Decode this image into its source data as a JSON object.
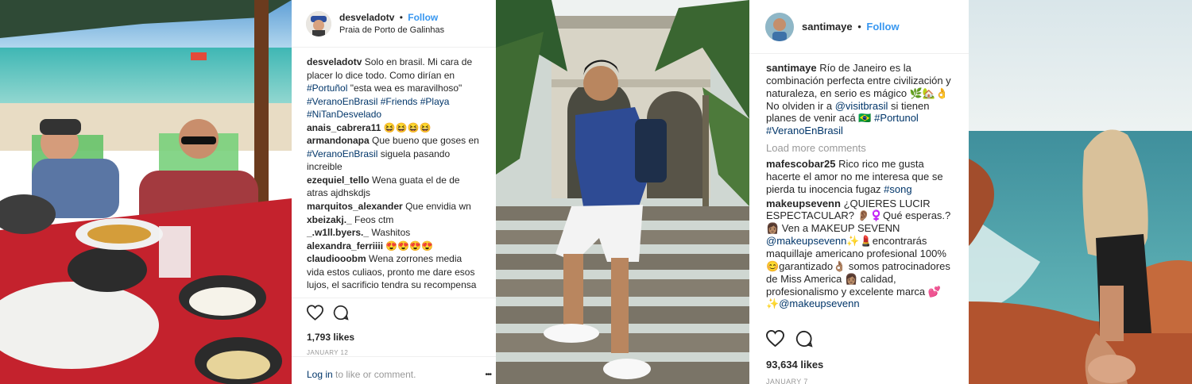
{
  "post1": {
    "username": "desveladotv",
    "separator": "•",
    "follow_label": "Follow",
    "location": "Praia de Porto de Galinhas",
    "caption": {
      "user": "desveladotv",
      "text": "Solo en brasil. Mi cara de placer lo dice todo. Como dirían en",
      "tag1": "#Portuñol",
      "text2": "\"esta wea es maravilhoso\"",
      "tags": "#VeranoEnBrasil #Friends #Playa #NiTanDesvelado"
    },
    "comments": [
      {
        "user": "anais_cabrera11",
        "text": "😆😆😆😆"
      },
      {
        "user": "armandonapa",
        "text": "Que bueno que goses en",
        "tag": "#VeranoEnBrasil",
        "text2": "siguela pasando increible"
      },
      {
        "user": "ezequiel_tello",
        "text": "Wena guata el de de atras ajdhskdjs"
      },
      {
        "user": "marquitos_alexander",
        "text": "Que envidia wn"
      },
      {
        "user": "xbeizakj._",
        "text": "Feos ctm"
      },
      {
        "user": "_.w1ll.byers._",
        "text": "Washitos"
      },
      {
        "user": "alexandra_ferriiii",
        "text": "😍😍😍😍"
      },
      {
        "user": "claudiooobm",
        "text": "Wena zorrones media vida estos culiaos, pronto me dare esos lujos, el sacrificio tendra su recompensa"
      }
    ],
    "likes": "1,793 likes",
    "date": "JANUARY 12",
    "login_label": "Log in",
    "login_suffix": "to like or comment.",
    "more_label": "•••"
  },
  "post2": {
    "username": "santimaye",
    "separator": "•",
    "follow_label": "Follow",
    "caption": {
      "user": "santimaye",
      "text": "Río de Janeiro es la combinación perfecta entre civilización y naturaleza, en serio es mágico 🌿🏡👌 No olviden ir a",
      "mention": "@visitbrasil",
      "text2": "si tienen planes de venir acá 🇧🇷",
      "tags": "#Portunol #VeranoEnBrasil"
    },
    "load_more": "Load more comments",
    "comments": [
      {
        "user": "mafescobar25",
        "text": "Rico rico me gusta hacerte el amor no me interesa que se pierda tu inocencia fugaz",
        "tag": "#song"
      },
      {
        "user": "makeupsevenn",
        "text": "¿QUIERES LUCIR ESPECTACULAR? 👂🏽♀️Qué esperas.? 👩🏽 Ven a MAKEUP SEVENN",
        "tag": "@makeupsevenn",
        "text2": "✨💄encontrarás maquillaje americano profesional 100% 😊garantizado👌🏽 somos patrocinadores de Miss America 👩🏽 calidad, profesionalismo y excelente marca 💕✨",
        "tag2": "@makeupsevenn"
      }
    ],
    "likes": "93,634 likes",
    "date": "JANUARY 7"
  },
  "colors": {
    "link_blue": "#3897f0",
    "hashtag_blue": "#003569",
    "muted_gray": "#999999",
    "text": "#262626"
  },
  "icons": [
    "heart-icon",
    "comment-icon",
    "more-options-icon"
  ]
}
